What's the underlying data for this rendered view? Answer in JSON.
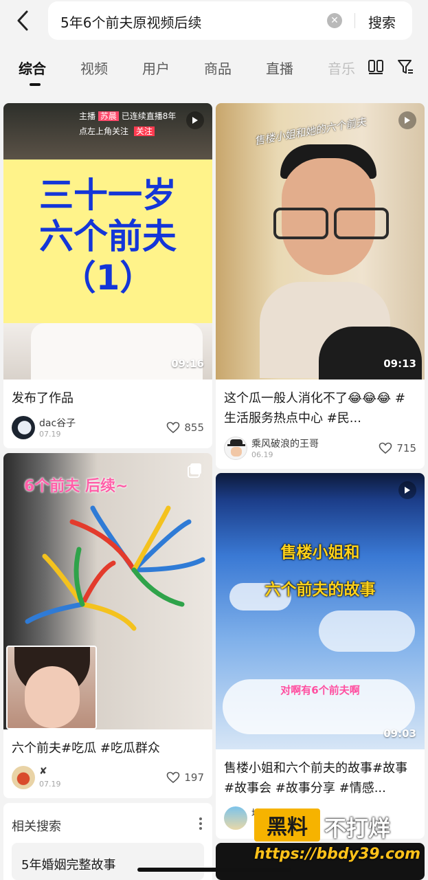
{
  "search": {
    "query": "5年6个前夫原视频后续",
    "submit_label": "搜索"
  },
  "tabs": [
    {
      "label": "综合",
      "active": true
    },
    {
      "label": "视频",
      "active": false
    },
    {
      "label": "用户",
      "active": false
    },
    {
      "label": "商品",
      "active": false
    },
    {
      "label": "直播",
      "active": false
    },
    {
      "label": "音乐",
      "active": false
    }
  ],
  "cards": [
    {
      "thumb_top_text_1": "主播",
      "thumb_top_name": "苏晨",
      "thumb_top_text_2": "已连续直播8年",
      "thumb_top_text_3": "点左上角关注",
      "thumb_follow": "关注",
      "overlay_line1": "三十一岁",
      "overlay_line2": "六个前夫",
      "overlay_line3": "（1）",
      "duration": "09:16",
      "title": "发布了作品",
      "author": "dac谷子",
      "date": "07.19",
      "likes": "855",
      "type": "video"
    },
    {
      "overlay_handwriting": "售楼小姐和她的六个前夫",
      "duration": "09:13",
      "title": "这个瓜一般人消化不了😂😂😂 #生活服务热点中心 #民...",
      "author": "乘风破浪的王哥",
      "date": "06.19",
      "likes": "715",
      "type": "video"
    },
    {
      "overlay_text": "6个前夫 后续~",
      "title": "六个前夫#吃瓜 #吃瓜群众",
      "author": "✘",
      "date": "07.19",
      "likes": "197",
      "type": "album"
    },
    {
      "overlay_line1": "售楼小姐和",
      "overlay_line2": "六个前夫的故事",
      "overlay_sub": "对啊有6个前夫啊",
      "duration": "09:03",
      "title": "售楼小姐和六个前夫的故事#故事 #故事会 #故事分享 #情感...",
      "author": "坤",
      "type": "video"
    }
  ],
  "related": {
    "title": "相关搜索",
    "items": [
      "5年婚姻完整故事"
    ]
  },
  "watermark": {
    "badge": "黑料",
    "text": "不打烊",
    "url": "https://bbdy39.com"
  },
  "colors": {
    "overlay_blue": "#1436d8",
    "overlay_yellow": "#fff38a",
    "pink_text": "#ff5fa8",
    "gold_text": "#ffd21a",
    "watermark_gold": "#f6b300"
  }
}
